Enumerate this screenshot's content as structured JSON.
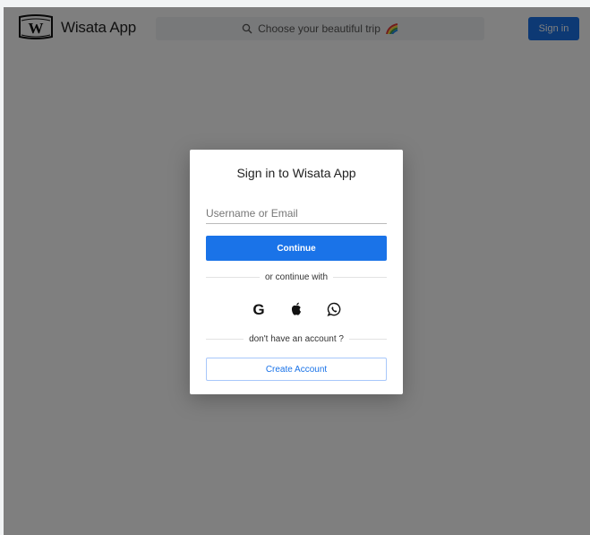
{
  "header": {
    "app_name": "Wisata App",
    "logo_letter": "W",
    "search_placeholder": "Choose your beautiful trip",
    "signin_label": "Sign in"
  },
  "modal": {
    "title": "Sign in to Wisata App",
    "username_placeholder": "Username or Email",
    "username_value": "",
    "continue_label": "Continue",
    "divider_continue": "or continue with",
    "social": [
      {
        "name": "google-icon",
        "glyph": "G"
      },
      {
        "name": "apple-icon"
      },
      {
        "name": "whatsapp-icon"
      }
    ],
    "divider_account": "don't have an account ?",
    "create_account_label": "Create Account"
  },
  "colors": {
    "accent": "#1a73e8",
    "overlay": "rgba(0,0,0,0.5)",
    "background": "#f1f3f4"
  }
}
